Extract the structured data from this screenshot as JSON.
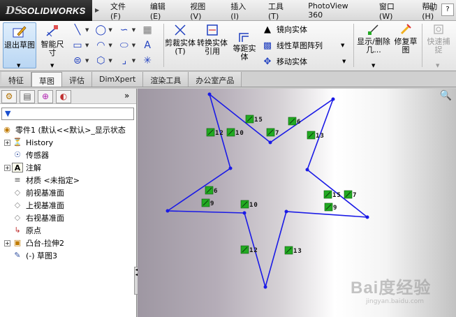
{
  "app": {
    "logo_ds": "DS",
    "logo_name": "SOLIDWORKS"
  },
  "menubar": [
    "文件(F)",
    "编辑(E)",
    "视图(V)",
    "插入(I)",
    "工具(T)",
    "PhotoView 360",
    "窗口(W)",
    "帮助(H)"
  ],
  "ribbon": {
    "exit_sketch": "退出草图",
    "smart_dimension": "智能尺寸",
    "trim": "剪裁实体(T)",
    "convert": "转换实体引用",
    "offset": "等距实体",
    "mirror": "镜向实体",
    "linear_pattern": "线性草图阵列",
    "move": "移动实体",
    "show_delete": "显示/删除几...",
    "repair": "修复草图",
    "quick_snap": "快速捕捉"
  },
  "tabs": [
    "特征",
    "草图",
    "评估",
    "DimXpert",
    "渲染工具",
    "办公室产品"
  ],
  "active_tab": 1,
  "tree": {
    "root": "零件1  (默认<<默认>_显示状态",
    "items": [
      {
        "label": "History",
        "expand": true
      },
      {
        "label": "传感器",
        "expand": false
      },
      {
        "label": "注解",
        "expand": true
      },
      {
        "label": "材质 <未指定>",
        "expand": false
      },
      {
        "label": "前视基准面",
        "expand": false
      },
      {
        "label": "上视基准面",
        "expand": false
      },
      {
        "label": "右视基准面",
        "expand": false
      },
      {
        "label": "原点",
        "expand": false
      },
      {
        "label": "凸台-拉伸2",
        "expand": true
      },
      {
        "label": "(-) 草图3",
        "expand": false
      }
    ]
  },
  "sketch": {
    "relations": [
      "15",
      "12",
      "10",
      "7",
      "6",
      "13",
      "6",
      "9",
      "10",
      "15",
      "7",
      "9",
      "12",
      "13"
    ]
  },
  "watermark": {
    "line1": "Bai度经验",
    "line2": "jingyan.baidu.com"
  },
  "colors": {
    "sketch_line": "#1a1ae6",
    "relation_box": "#22aa22"
  }
}
